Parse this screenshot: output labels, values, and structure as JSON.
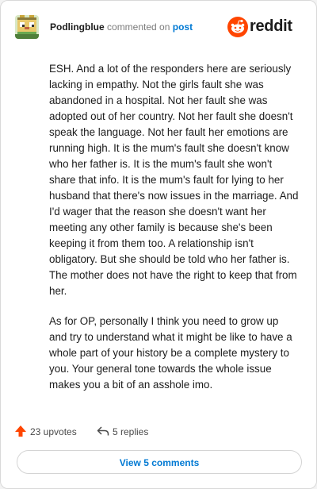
{
  "header": {
    "username": "Podlingblue",
    "action_text": "commented on",
    "post_link": "post",
    "brand": "reddit",
    "avatar_icon": "pixel-avatar-icon",
    "brand_icon": "reddit-alien-icon"
  },
  "comment": {
    "paragraphs": [
      "ESH. And a lot of the responders here are seriously lacking in empathy. Not the girls fault she was abandoned in a hospital. Not her fault she was adopted out of her country. Not her fault she doesn't speak the language. Not her fault her emotions are running high. It is the mum's fault she doesn't know who her father is. It is the mum's fault she won't share that info. It is the mum's fault for lying to her husband that there's now issues in the marriage. And I'd wager that the reason she doesn't want her meeting any other family is because she's been keeping it from them too. A relationship isn't obligatory. But she should be told who her father is. The mother does not have the right to keep that from her.",
      "As for OP, personally I think you need to grow up and try to understand what it might be like to have a whole part of your history be a complete mystery to you. Your general tone towards the whole issue makes you a bit of an asshole imo."
    ]
  },
  "actions": {
    "upvotes": "23 upvotes",
    "replies": "5 replies",
    "upvote_icon": "upvote-arrow-icon",
    "reply_icon": "reply-arrow-icon"
  },
  "footer": {
    "view_comments": "View 5 comments"
  },
  "colors": {
    "reddit_orange": "#ff4500",
    "link_blue": "#0079d3",
    "upvote": "#ff4500"
  }
}
